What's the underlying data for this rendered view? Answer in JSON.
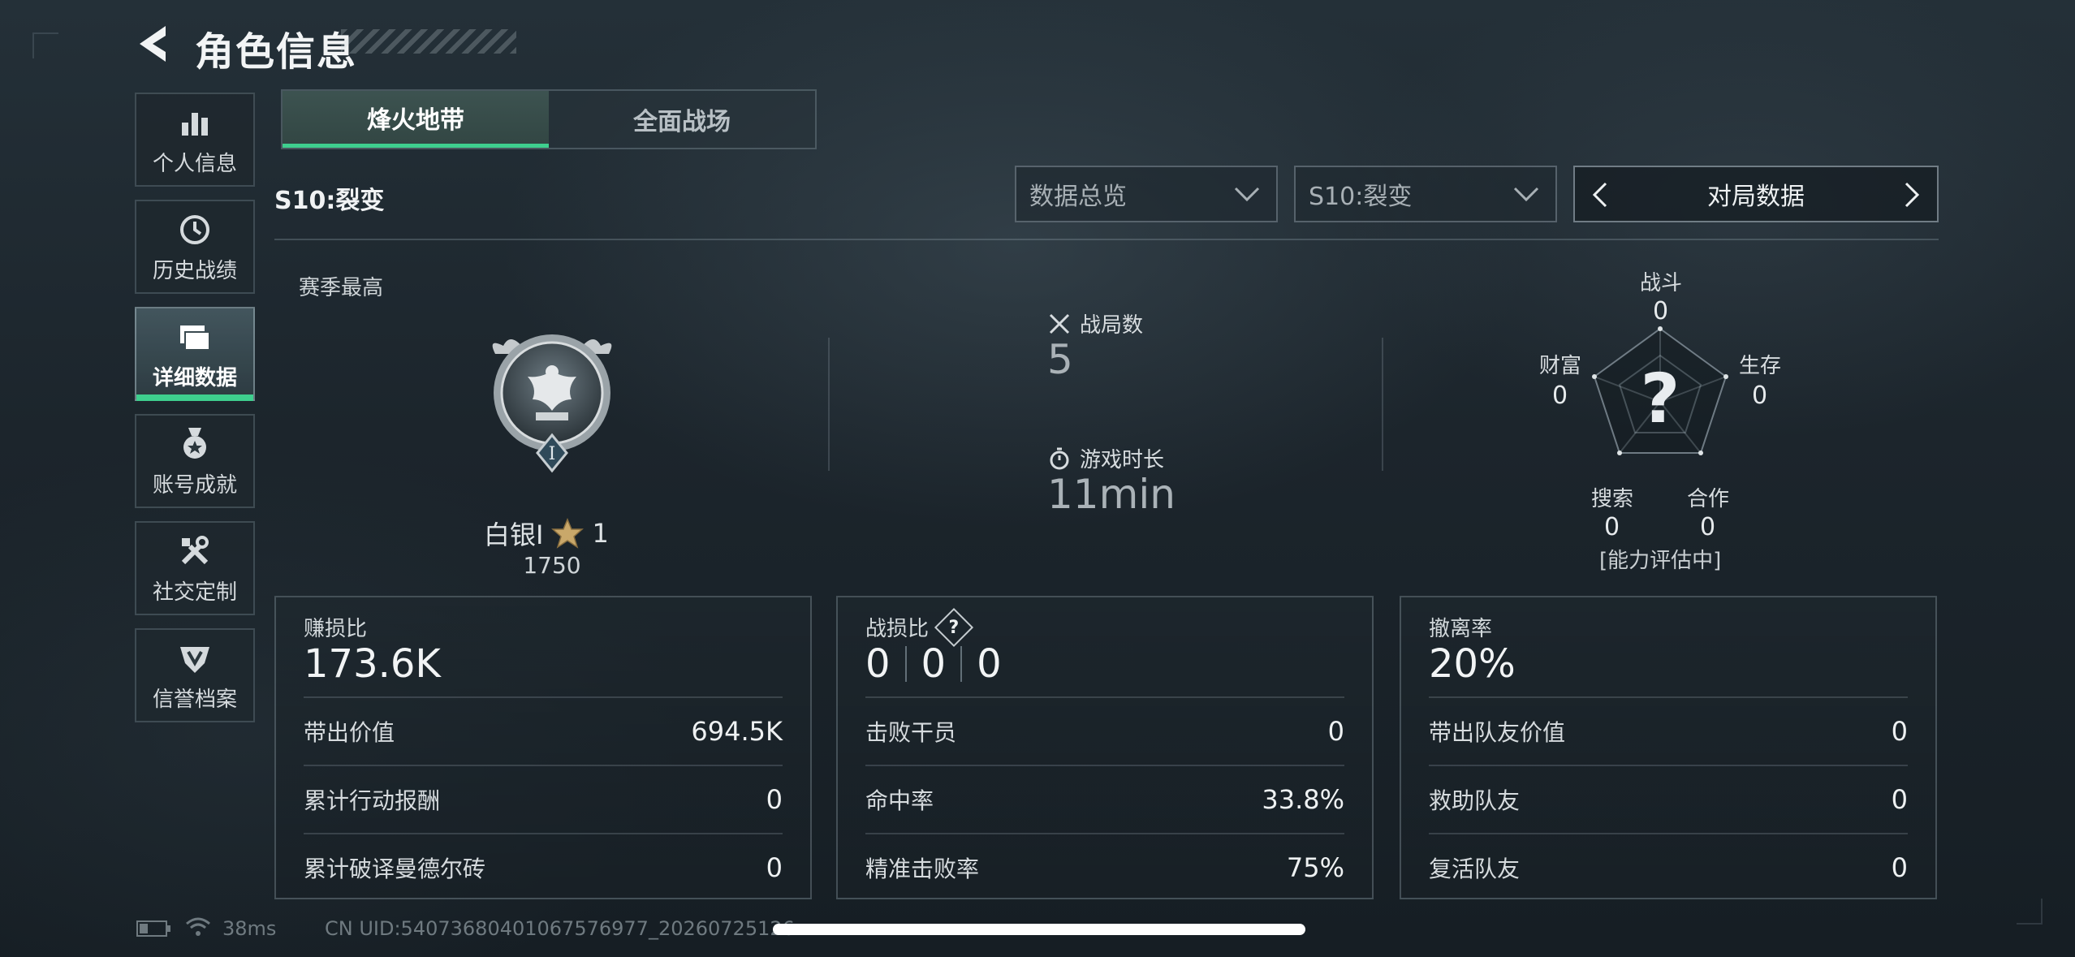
{
  "header": {
    "title": "角色信息"
  },
  "sidebar": {
    "items": [
      {
        "label": "个人信息",
        "icon": "bar-chart-icon"
      },
      {
        "label": "历史战绩",
        "icon": "history-clock-icon"
      },
      {
        "label": "详细数据",
        "icon": "folder-icon",
        "active": true
      },
      {
        "label": "账号成就",
        "icon": "medal-icon"
      },
      {
        "label": "社交定制",
        "icon": "tools-icon"
      },
      {
        "label": "信誉档案",
        "icon": "shield-icon"
      }
    ]
  },
  "tabs": [
    {
      "label": "烽火地带",
      "active": true
    },
    {
      "label": "全面战场",
      "active": false
    }
  ],
  "season_label": "S10:裂变",
  "filters": {
    "overview": "数据总览",
    "season": "S10:裂变",
    "pager_label": "对局数据"
  },
  "rank": {
    "section_label": "赛季最高",
    "tier": "白银I",
    "stars": "1",
    "score": "1750"
  },
  "stats": {
    "matches_label": "战局数",
    "matches_value": "5",
    "playtime_label": "游戏时长",
    "playtime_value": "11min"
  },
  "radar": {
    "axes": [
      {
        "label": "战斗",
        "value": "0"
      },
      {
        "label": "生存",
        "value": "0"
      },
      {
        "label": "合作",
        "value": "0"
      },
      {
        "label": "搜索",
        "value": "0"
      },
      {
        "label": "财富",
        "value": "0"
      }
    ],
    "center_mark": "?",
    "status": "[能力评估中]"
  },
  "panels": {
    "profit": {
      "title": "赚损比",
      "value": "173.6K",
      "rows": [
        {
          "label": "带出价值",
          "value": "694.5K"
        },
        {
          "label": "累计行动报酬",
          "value": "0"
        },
        {
          "label": "累计破译曼德尔砖",
          "value": "0"
        }
      ]
    },
    "combat": {
      "title": "战损比",
      "help": "?",
      "values": [
        "0",
        "0",
        "0"
      ],
      "rows": [
        {
          "label": "击败干员",
          "value": "0"
        },
        {
          "label": "命中率",
          "value": "33.8%"
        },
        {
          "label": "精准击败率",
          "value": "75%"
        }
      ]
    },
    "extract": {
      "title": "撤离率",
      "value": "20%",
      "rows": [
        {
          "label": "带出队友价值",
          "value": "0"
        },
        {
          "label": "救助队友",
          "value": "0"
        },
        {
          "label": "复活队友",
          "value": "0"
        }
      ]
    }
  },
  "status_bar": {
    "ping": "38ms",
    "uid": "CN UID:54073680401067576977_20260725126"
  },
  "colors": {
    "accent": "#3ecf8e",
    "bg": "#1c252c"
  }
}
